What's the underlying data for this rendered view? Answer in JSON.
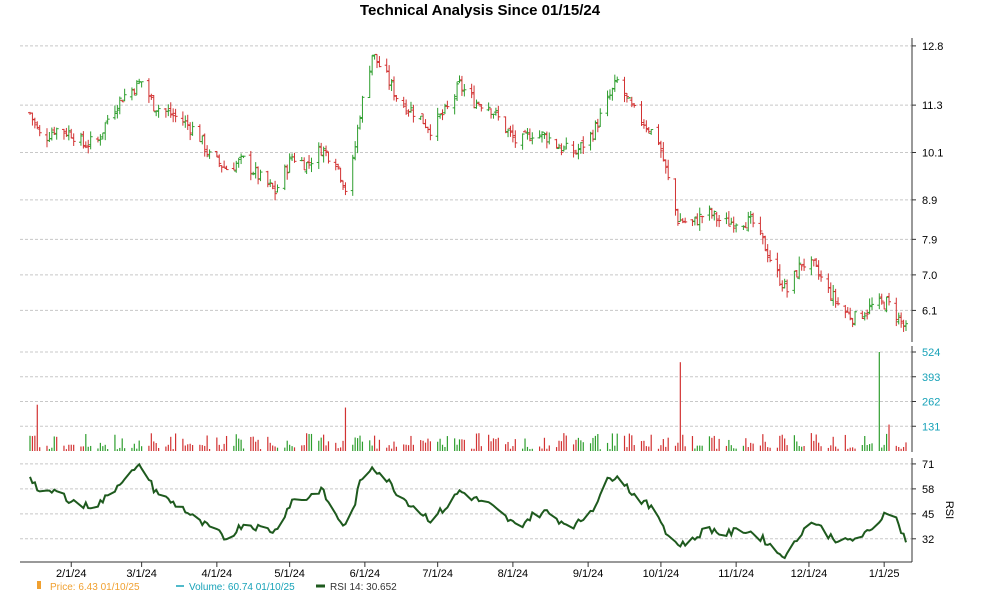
{
  "chart_data": {
    "title": "Technical Analysis Since 01/15/24",
    "type": "ohlc",
    "x_tick_labels": [
      "2/1/24",
      "3/1/24",
      "4/1/24",
      "5/1/24",
      "6/1/24",
      "7/1/24",
      "8/1/24",
      "9/1/24",
      "10/1/24",
      "11/1/24",
      "12/1/24",
      "1/1/25"
    ],
    "price_panel": {
      "type": "ohlc",
      "yticks": [
        6.1,
        7.0,
        7.9,
        8.9,
        10.1,
        11.3,
        12.8
      ],
      "ylim": [
        5.3,
        13.0
      ],
      "up_color": "#2e9e2e",
      "down_color": "#d23232",
      "anchors": [
        [
          "2024-01-15",
          11.1
        ],
        [
          "2024-01-20",
          10.4
        ],
        [
          "2024-01-25",
          10.7
        ],
        [
          "2024-02-01",
          10.6
        ],
        [
          "2024-02-06",
          10.3
        ],
        [
          "2024-02-12",
          10.4
        ],
        [
          "2024-02-17",
          11.1
        ],
        [
          "2024-02-22",
          11.5
        ],
        [
          "2024-03-01",
          11.9
        ],
        [
          "2024-03-06",
          11.3
        ],
        [
          "2024-03-12",
          11.1
        ],
        [
          "2024-03-18",
          10.9
        ],
        [
          "2024-03-24",
          10.6
        ],
        [
          "2024-03-29",
          10.0
        ],
        [
          "2024-04-05",
          9.7
        ],
        [
          "2024-04-12",
          9.9
        ],
        [
          "2024-04-18",
          9.5
        ],
        [
          "2024-04-25",
          9.1
        ],
        [
          "2024-05-02",
          10.0
        ],
        [
          "2024-05-08",
          9.8
        ],
        [
          "2024-05-14",
          10.2
        ],
        [
          "2024-05-20",
          9.9
        ],
        [
          "2024-05-25",
          9.0
        ],
        [
          "2024-05-30",
          11.1
        ],
        [
          "2024-06-04",
          12.6
        ],
        [
          "2024-06-10",
          12.0
        ],
        [
          "2024-06-15",
          11.4
        ],
        [
          "2024-06-22",
          11.1
        ],
        [
          "2024-06-28",
          10.7
        ],
        [
          "2024-07-05",
          11.2
        ],
        [
          "2024-07-10",
          11.8
        ],
        [
          "2024-07-16",
          11.4
        ],
        [
          "2024-07-22",
          11.3
        ],
        [
          "2024-07-29",
          10.7
        ],
        [
          "2024-08-03",
          10.3
        ],
        [
          "2024-08-09",
          10.6
        ],
        [
          "2024-08-15",
          10.5
        ],
        [
          "2024-08-21",
          10.2
        ],
        [
          "2024-08-27",
          10.1
        ],
        [
          "2024-09-03",
          10.6
        ],
        [
          "2024-09-09",
          11.4
        ],
        [
          "2024-09-13",
          11.9
        ],
        [
          "2024-09-19",
          11.2
        ],
        [
          "2024-09-25",
          10.8
        ],
        [
          "2024-09-30",
          10.4
        ],
        [
          "2024-10-04",
          9.4
        ],
        [
          "2024-10-08",
          8.4
        ],
        [
          "2024-10-14",
          8.3
        ],
        [
          "2024-10-20",
          8.6
        ],
        [
          "2024-10-27",
          8.3
        ],
        [
          "2024-11-03",
          8.4
        ],
        [
          "2024-11-08",
          8.3
        ],
        [
          "2024-11-13",
          7.7
        ],
        [
          "2024-11-18",
          7.0
        ],
        [
          "2024-11-22",
          6.6
        ],
        [
          "2024-11-28",
          7.3
        ],
        [
          "2024-12-03",
          7.2
        ],
        [
          "2024-12-09",
          6.6
        ],
        [
          "2024-12-15",
          6.1
        ],
        [
          "2024-12-20",
          5.9
        ],
        [
          "2024-12-27",
          6.2
        ],
        [
          "2025-01-02",
          6.3
        ],
        [
          "2025-01-06",
          6.0
        ],
        [
          "2025-01-10",
          5.6
        ]
      ],
      "last_price": 6.43,
      "last_date": "01/10/25"
    },
    "volume_panel": {
      "type": "bar",
      "yticks": [
        131,
        262,
        393,
        524
      ],
      "ylim": [
        0,
        524
      ],
      "spikes": [
        [
          "2024-01-18",
          245
        ],
        [
          "2024-05-24",
          230
        ],
        [
          "2024-10-09",
          470
        ],
        [
          "2024-10-12",
          170
        ],
        [
          "2024-12-30",
          524
        ],
        [
          "2025-01-03",
          140
        ]
      ],
      "baseline_range": [
        25,
        95
      ],
      "last_volume": 60.74,
      "last_date": "01/10/25"
    },
    "rsi_panel": {
      "type": "line",
      "yticks": [
        32,
        45,
        58,
        71
      ],
      "ylim": [
        22,
        72
      ],
      "ylabel": "RSI",
      "color": "#1e5a1e",
      "period": 14,
      "anchors": [
        [
          "2024-01-15",
          65
        ],
        [
          "2024-01-20",
          54
        ],
        [
          "2024-01-25",
          57
        ],
        [
          "2024-02-01",
          52
        ],
        [
          "2024-02-06",
          49
        ],
        [
          "2024-02-12",
          50
        ],
        [
          "2024-02-17",
          55
        ],
        [
          "2024-02-22",
          63
        ],
        [
          "2024-03-01",
          70
        ],
        [
          "2024-03-06",
          58
        ],
        [
          "2024-03-12",
          52
        ],
        [
          "2024-03-18",
          48
        ],
        [
          "2024-03-24",
          41
        ],
        [
          "2024-03-29",
          38
        ],
        [
          "2024-04-05",
          32
        ],
        [
          "2024-04-12",
          40
        ],
        [
          "2024-04-18",
          38
        ],
        [
          "2024-04-25",
          36
        ],
        [
          "2024-05-02",
          52
        ],
        [
          "2024-05-08",
          53
        ],
        [
          "2024-05-14",
          58
        ],
        [
          "2024-05-20",
          44
        ],
        [
          "2024-05-25",
          37
        ],
        [
          "2024-05-30",
          61
        ],
        [
          "2024-06-04",
          70
        ],
        [
          "2024-06-10",
          63
        ],
        [
          "2024-06-15",
          55
        ],
        [
          "2024-06-22",
          48
        ],
        [
          "2024-06-28",
          42
        ],
        [
          "2024-07-05",
          49
        ],
        [
          "2024-07-10",
          57
        ],
        [
          "2024-07-16",
          53
        ],
        [
          "2024-07-22",
          50
        ],
        [
          "2024-07-29",
          43
        ],
        [
          "2024-08-03",
          38
        ],
        [
          "2024-08-09",
          44
        ],
        [
          "2024-08-15",
          46
        ],
        [
          "2024-08-21",
          41
        ],
        [
          "2024-08-27",
          39
        ],
        [
          "2024-09-03",
          48
        ],
        [
          "2024-09-09",
          62
        ],
        [
          "2024-09-13",
          66
        ],
        [
          "2024-09-19",
          56
        ],
        [
          "2024-09-25",
          50
        ],
        [
          "2024-09-30",
          44
        ],
        [
          "2024-10-04",
          34
        ],
        [
          "2024-10-08",
          29
        ],
        [
          "2024-10-14",
          31
        ],
        [
          "2024-10-20",
          38
        ],
        [
          "2024-10-27",
          34
        ],
        [
          "2024-11-03",
          37
        ],
        [
          "2024-11-08",
          35
        ],
        [
          "2024-11-13",
          31
        ],
        [
          "2024-11-18",
          25
        ],
        [
          "2024-11-22",
          23
        ],
        [
          "2024-11-28",
          36
        ],
        [
          "2024-12-03",
          41
        ],
        [
          "2024-12-09",
          34
        ],
        [
          "2024-12-15",
          30
        ],
        [
          "2024-12-20",
          32
        ],
        [
          "2024-12-27",
          36
        ],
        [
          "2025-01-02",
          47
        ],
        [
          "2025-01-06",
          42
        ],
        [
          "2025-01-10",
          31
        ]
      ],
      "last_value": 30.652
    },
    "legend": {
      "position": "bottom-left",
      "entries": [
        {
          "marker": "bar",
          "color": "#f0a030",
          "text": "Price: 6.43  01/10/25"
        },
        {
          "marker": "dash",
          "color": "#17a2b8",
          "text": "Volume: 60.74  01/10/25"
        },
        {
          "marker": "line",
          "color": "#1e5a1e",
          "text": "RSI 14: 30.652"
        }
      ]
    },
    "grid": true
  }
}
